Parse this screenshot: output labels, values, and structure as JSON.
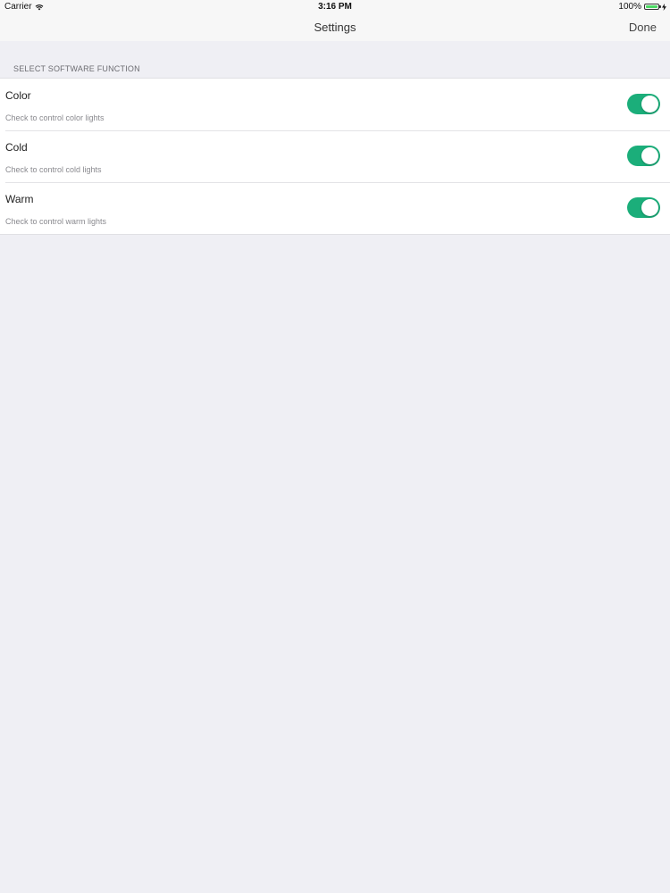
{
  "status_bar": {
    "carrier": "Carrier",
    "time": "3:16 PM",
    "battery": "100%",
    "wifi_icon": "wifi-icon",
    "battery_icon": "battery-icon",
    "charging_icon": "charging-bolt-icon",
    "battery_level": 1.0,
    "battery_color": "#4cd964"
  },
  "nav": {
    "title": "Settings",
    "done_label": "Done"
  },
  "section": {
    "header": "SELECT SOFTWARE FUNCTION"
  },
  "settings": [
    {
      "title": "Color",
      "subtitle": "Check to control color lights",
      "enabled": true
    },
    {
      "title": "Cold",
      "subtitle": "Check to control cold lights",
      "enabled": true
    },
    {
      "title": "Warm",
      "subtitle": "Check to control warm lights",
      "enabled": true
    }
  ],
  "colors": {
    "toggle_on": "#1bae7a",
    "background": "#efeff4"
  }
}
